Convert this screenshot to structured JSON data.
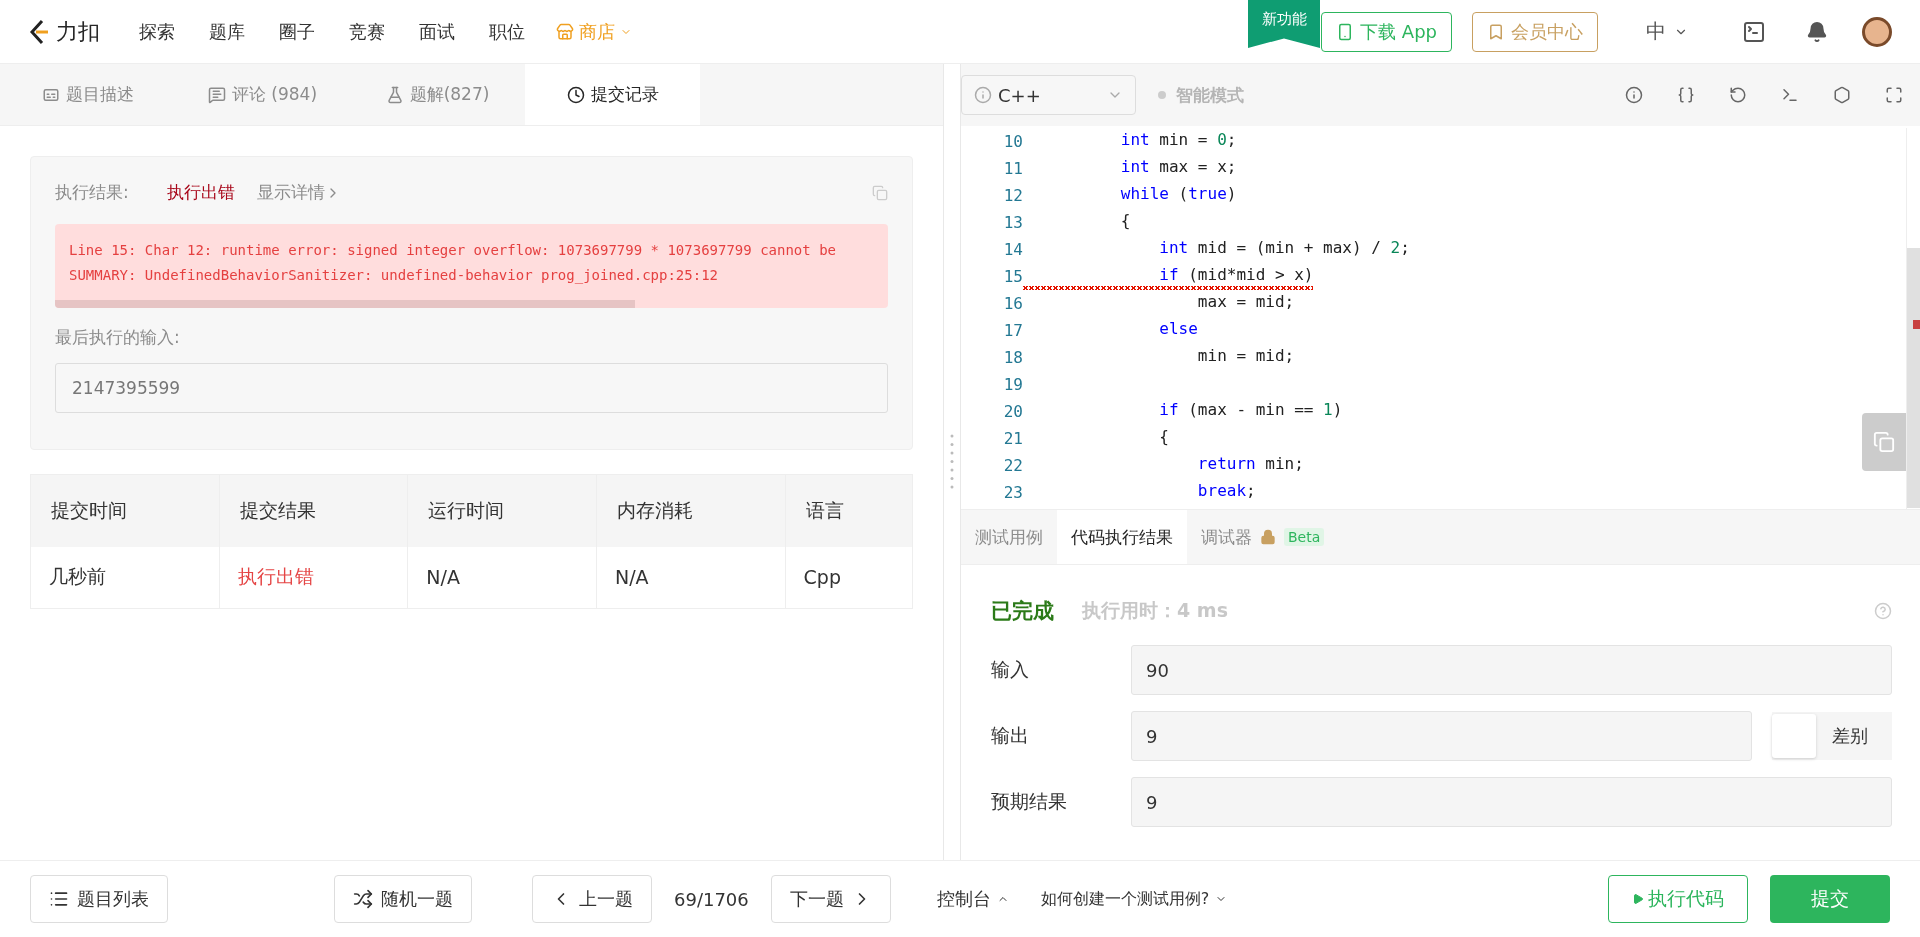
{
  "nav": {
    "logo": "力扣",
    "links": [
      {
        "label": "探索",
        "selected": false
      },
      {
        "label": "题库",
        "selected": false
      },
      {
        "label": "圈子",
        "selected": false
      },
      {
        "label": "竞赛",
        "selected": false
      },
      {
        "label": "面试",
        "selected": false
      },
      {
        "label": "职位",
        "selected": false
      }
    ],
    "shop": "商店",
    "new_badge": "新功能",
    "download": "下载 App",
    "vip": "会员中心",
    "lang": "中"
  },
  "left_tabs": [
    {
      "label": "题目描述",
      "selected": false,
      "kind": "desc"
    },
    {
      "label": "评论 (984)",
      "selected": false,
      "kind": "comment"
    },
    {
      "label": "题解(827)",
      "selected": false,
      "kind": "solution"
    },
    {
      "label": "提交记录",
      "selected": true,
      "kind": "history"
    }
  ],
  "result": {
    "label": "执行结果:",
    "status": "执行出错",
    "details": "显示详情",
    "error_lines": [
      "Line 15: Char 12: runtime error: signed integer overflow: 1073697799 * 1073697799 cannot be",
      "SUMMARY: UndefinedBehaviorSanitizer: undefined-behavior prog_joined.cpp:25:12"
    ],
    "last_input_label": "最后执行的输入:",
    "last_input": "2147395599"
  },
  "submissions": {
    "columns": [
      "提交时间",
      "提交结果",
      "运行时间",
      "内存消耗",
      "语言"
    ],
    "rows": [
      {
        "time": "几秒前",
        "result": "执行出错",
        "runtime": "N/A",
        "memory": "N/A",
        "language": "Cpp"
      }
    ]
  },
  "editor": {
    "language": "C++",
    "smart_mode": "智能模式",
    "lines": [
      {
        "no": "10",
        "error": false,
        "tokens": [
          {
            "t": "      int",
            "kind": "keyword"
          },
          {
            "t": " min = ",
            "kind": "plain"
          },
          {
            "t": "0",
            "kind": "number"
          },
          {
            "t": ";",
            "kind": "plain"
          }
        ]
      },
      {
        "no": "11",
        "error": false,
        "tokens": [
          {
            "t": "      int",
            "kind": "keyword"
          },
          {
            "t": " max = x;",
            "kind": "plain"
          }
        ]
      },
      {
        "no": "12",
        "error": false,
        "tokens": [
          {
            "t": "      while",
            "kind": "keyword"
          },
          {
            "t": " (",
            "kind": "plain"
          },
          {
            "t": "true",
            "kind": "keyword"
          },
          {
            "t": ")",
            "kind": "plain"
          }
        ]
      },
      {
        "no": "13",
        "error": false,
        "tokens": [
          {
            "t": "      {",
            "kind": "plain"
          }
        ]
      },
      {
        "no": "14",
        "error": false,
        "tokens": [
          {
            "t": "          int",
            "kind": "keyword"
          },
          {
            "t": " mid = (min + max) / ",
            "kind": "plain"
          },
          {
            "t": "2",
            "kind": "number"
          },
          {
            "t": ";",
            "kind": "plain"
          }
        ]
      },
      {
        "no": "15",
        "error": true,
        "tokens": [
          {
            "t": "          if",
            "kind": "keyword"
          },
          {
            "t": " (mid*mid > x)",
            "kind": "plain"
          }
        ]
      },
      {
        "no": "16",
        "error": false,
        "tokens": [
          {
            "t": "              max = mid;",
            "kind": "plain"
          }
        ]
      },
      {
        "no": "17",
        "error": false,
        "tokens": [
          {
            "t": "          else",
            "kind": "keyword"
          }
        ]
      },
      {
        "no": "18",
        "error": false,
        "tokens": [
          {
            "t": "              min = mid;",
            "kind": "plain"
          }
        ]
      },
      {
        "no": "19"
      },
      {
        "no": "20",
        "error": false,
        "tokens": [
          {
            "t": "          if",
            "kind": "keyword"
          },
          {
            "t": " (max - min == ",
            "kind": "plain"
          },
          {
            "t": "1",
            "kind": "number"
          },
          {
            "t": ")",
            "kind": "plain"
          }
        ]
      },
      {
        "no": "21",
        "error": false,
        "tokens": [
          {
            "t": "          {",
            "kind": "plain"
          }
        ]
      },
      {
        "no": "22",
        "error": false,
        "tokens": [
          {
            "t": "              return",
            "kind": "keyword"
          },
          {
            "t": " min;",
            "kind": "plain"
          }
        ]
      },
      {
        "no": "23",
        "error": false,
        "tokens": [
          {
            "t": "              break",
            "kind": "keyword"
          },
          {
            "t": ";",
            "kind": "plain"
          }
        ]
      }
    ]
  },
  "console_tabs": [
    {
      "label": "测试用例",
      "selected": false
    },
    {
      "label": "代码执行结果",
      "selected": true
    },
    {
      "label": "调试器",
      "selected": false,
      "locked": true,
      "badge": "Beta"
    }
  ],
  "run": {
    "status": "已完成",
    "time": "执行用时：4 ms",
    "fields": [
      {
        "label": "输入",
        "value": "90"
      },
      {
        "label": "输出",
        "value": "9",
        "diff": {
          "label": "差别",
          "checked": false
        }
      },
      {
        "label": "预期结果",
        "value": "9"
      }
    ]
  },
  "bottom": {
    "problem_list": "题目列表",
    "random": "随机一题",
    "prev": "上一题",
    "counter": "69/1706",
    "next": "下一题",
    "console": "控制台",
    "help": "如何创建一个测试用例?",
    "run": "执行代码",
    "submit": "提交"
  }
}
